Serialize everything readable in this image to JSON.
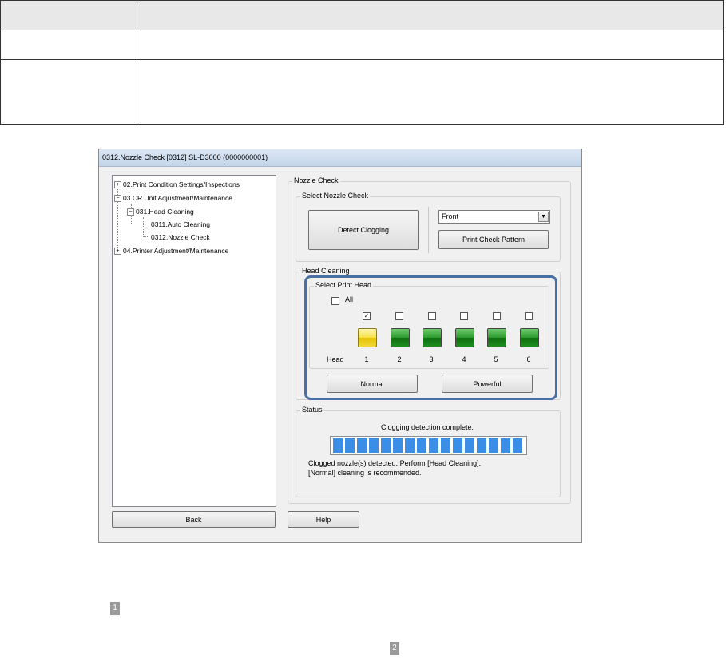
{
  "window": {
    "title": "0312.Nozzle Check  [0312]  SL-D3000  (0000000001)"
  },
  "tree": {
    "items": [
      {
        "label": "02.Print Condition Settings/Inspections",
        "expander": "+"
      },
      {
        "label": "03.CR Unit Adjustment/Maintenance",
        "expander": "−"
      },
      {
        "label": "031.Head Cleaning",
        "expander": "−"
      },
      {
        "label": "0311.Auto Cleaning"
      },
      {
        "label": "0312.Nozzle Check"
      },
      {
        "label": "04.Printer Adjustment/Maintenance",
        "expander": "+"
      }
    ]
  },
  "nozzle_check": {
    "group_label": "Nozzle Check",
    "select_label": "Select Nozzle Check",
    "detect_button": "Detect Clogging",
    "side_value": "Front",
    "print_pattern_button": "Print Check Pattern"
  },
  "head_cleaning": {
    "group_label": "Head Cleaning",
    "select_label": "Select Print Head",
    "all_label": "All",
    "head_label": "Head",
    "heads": [
      {
        "number": "1",
        "checked": true,
        "color": "yellow"
      },
      {
        "number": "2",
        "checked": false,
        "color": "green"
      },
      {
        "number": "3",
        "checked": false,
        "color": "green"
      },
      {
        "number": "4",
        "checked": false,
        "color": "green"
      },
      {
        "number": "5",
        "checked": false,
        "color": "green"
      },
      {
        "number": "6",
        "checked": false,
        "color": "green"
      }
    ],
    "normal_button": "Normal",
    "powerful_button": "Powerful"
  },
  "status": {
    "group_label": "Status",
    "message": "Clogging detection complete.",
    "progress": 1.0,
    "detail_line1": "Clogged nozzle(s) detected. Perform [Head Cleaning].",
    "detail_line2": "[Normal] cleaning is recommended."
  },
  "footer": {
    "back_button": "Back",
    "help_button": "Help"
  },
  "markers": {
    "first": "1",
    "second": "2"
  },
  "colors": {
    "highlight": "#4a6fa5",
    "progress": "#3a8ee6",
    "marker": "#9a9a9a"
  }
}
